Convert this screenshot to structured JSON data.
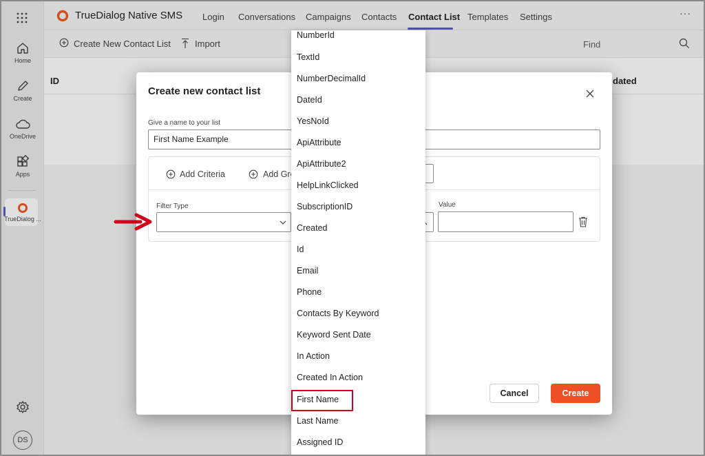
{
  "app": {
    "title": "TrueDialog Native SMS"
  },
  "nav_tabs": [
    "Login",
    "Conversations",
    "Campaigns",
    "Contacts",
    "Contact List",
    "Templates",
    "Settings"
  ],
  "active_tab": "Contact List",
  "more_label": "···",
  "rail": {
    "items": [
      {
        "label": "Home",
        "icon": "home-icon"
      },
      {
        "label": "Create",
        "icon": "pen-icon"
      },
      {
        "label": "OneDrive",
        "icon": "cloud-icon"
      },
      {
        "label": "Apps",
        "icon": "apps-icon"
      },
      {
        "label": "TrueDialog ...",
        "icon": "truedialog-logo-icon"
      }
    ],
    "settings_icon": "gear-icon",
    "avatar_initials": "DS"
  },
  "toolbar": {
    "create_label": "Create New Contact List",
    "import_label": "Import",
    "find_label": "Find"
  },
  "table": {
    "headers": [
      "ID",
      "dated"
    ]
  },
  "dialog": {
    "title": "Create new contact list",
    "name_label": "Give a name to your list",
    "name_value": "First Name Example",
    "add_criteria": "Add Criteria",
    "add_group": "Add Gro",
    "filter_type_label": "Filter Type",
    "filter_type_value": "",
    "value_label": "Value",
    "value_value": "",
    "cancel_label": "Cancel",
    "create_label": "Create"
  },
  "dropdown": {
    "options": [
      "NumberId",
      "TextId",
      "NumberDecimalId",
      "DateId",
      "YesNoId",
      "ApiAttribute",
      "ApiAttribute2",
      "HelpLinkClicked",
      "SubscriptionID",
      "Created",
      "Id",
      "Email",
      "Phone",
      "Contacts By Keyword",
      "Keyword Sent Date",
      "In Action",
      "Created In Action",
      "First Name",
      "Last Name",
      "Assigned ID"
    ],
    "highlighted": "First Name"
  },
  "colors": {
    "accent": "#5b5fc7",
    "create_button": "#f05025",
    "annotation_red": "#d0021b",
    "logo_orange": "#f05a22"
  }
}
